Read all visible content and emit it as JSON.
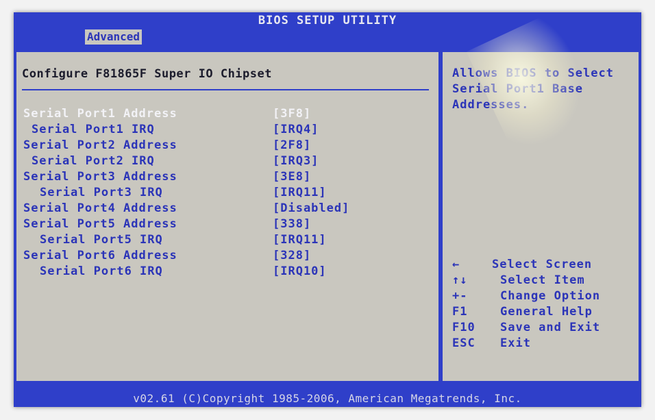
{
  "title": "BIOS SETUP UTILITY",
  "tabs": [
    {
      "label": "Advanced",
      "active": true
    }
  ],
  "panel_title": "Configure F81865F Super IO Chipset",
  "settings": [
    {
      "label": "Serial Port1 Address",
      "value": "[3F8]",
      "indent": 0,
      "selected": true
    },
    {
      "label": "Serial Port1 IRQ",
      "value": "[IRQ4]",
      "indent": 1,
      "selected": false
    },
    {
      "label": "Serial Port2 Address",
      "value": "[2F8]",
      "indent": 0,
      "selected": false
    },
    {
      "label": "Serial Port2 IRQ",
      "value": "[IRQ3]",
      "indent": 1,
      "selected": false
    },
    {
      "label": "Serial Port3 Address",
      "value": "[3E8]",
      "indent": 0,
      "selected": false
    },
    {
      "label": "Serial Port3 IRQ",
      "value": "[IRQ11]",
      "indent": 2,
      "selected": false
    },
    {
      "label": "Serial Port4 Address",
      "value": "[Disabled]",
      "indent": 0,
      "selected": false
    },
    {
      "label": "Serial Port5 Address",
      "value": "[338]",
      "indent": 0,
      "selected": false
    },
    {
      "label": "Serial Port5 IRQ",
      "value": "[IRQ11]",
      "indent": 2,
      "selected": false
    },
    {
      "label": "Serial Port6 Address",
      "value": "[328]",
      "indent": 0,
      "selected": false
    },
    {
      "label": "Serial Port6 IRQ",
      "value": "[IRQ10]",
      "indent": 2,
      "selected": false
    }
  ],
  "help_text": "Allows BIOS to Select Serial Port1 Base Addresses.",
  "key_legend": [
    {
      "key": "←",
      "description": "Select Screen"
    },
    {
      "key": "↑↓",
      "description": "Select Item"
    },
    {
      "key": "+-",
      "description": "Change Option"
    },
    {
      "key": "F1",
      "description": "General Help"
    },
    {
      "key": "F10",
      "description": "Save and Exit"
    },
    {
      "key": "ESC",
      "description": "Exit"
    }
  ],
  "footer": "v02.61 (C)Copyright 1985-2006, American Megatrends, Inc.",
  "colors": {
    "blue": "#2f3fc9",
    "background": "#c9c7bf",
    "text": "#2b34b8",
    "highlight": "#f2f2f6"
  }
}
